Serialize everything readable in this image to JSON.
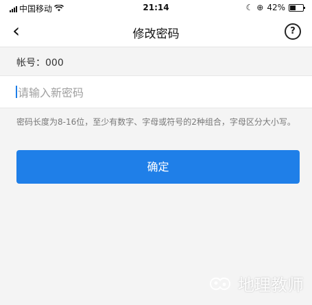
{
  "status_bar": {
    "carrier": "中国移动",
    "time": "21:14",
    "battery": "42%",
    "battery_level": 0.42
  },
  "nav": {
    "title": "修改密码",
    "back_icon": "‹",
    "help_icon": "?"
  },
  "account": {
    "label": "帐号：000"
  },
  "password_input": {
    "value": "",
    "placeholder": "请输入新密码"
  },
  "hint": "密码长度为8-16位，至少有数字、字母或符号的2种组合，字母区分大小写。",
  "confirm_label": "确定",
  "watermark": "地理教师"
}
